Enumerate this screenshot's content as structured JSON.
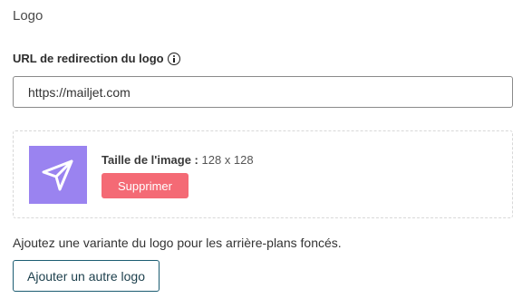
{
  "section": {
    "title": "Logo"
  },
  "redirect": {
    "label": "URL de redirection du logo",
    "value": "https://mailjet.com",
    "info_icon": "info-icon"
  },
  "logo": {
    "thumb_color": "#9a83f0",
    "thumb_icon": "send-plane-icon",
    "size_label": "Taille de l'image :",
    "size_value": "128 x 128",
    "delete_label": "Supprimer",
    "delete_color": "#f46a75"
  },
  "variant": {
    "help_text": "Ajoutez une variante du logo pour les arrière-plans foncés.",
    "add_label": "Ajouter un autre logo"
  }
}
